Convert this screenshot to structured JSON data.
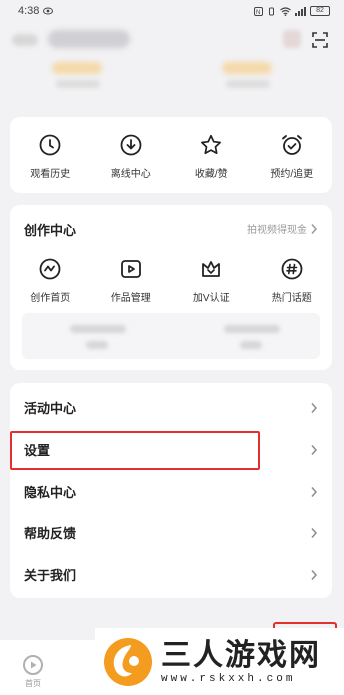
{
  "status_bar": {
    "time": "4:38",
    "battery": "82"
  },
  "quick_actions": [
    {
      "label": "观看历史",
      "icon": "clock-icon"
    },
    {
      "label": "离线中心",
      "icon": "download-cloud-icon"
    },
    {
      "label": "收藏/赞",
      "icon": "star-icon"
    },
    {
      "label": "预约/追更",
      "icon": "alarm-clock-icon"
    }
  ],
  "creator": {
    "title": "创作中心",
    "link": "拍视频得现金",
    "items": [
      {
        "label": "创作首页",
        "icon": "creator-home-icon"
      },
      {
        "label": "作品管理",
        "icon": "video-manage-icon"
      },
      {
        "label": "加V认证",
        "icon": "verify-crown-icon"
      },
      {
        "label": "热门话题",
        "icon": "hashtag-icon"
      }
    ]
  },
  "menu": [
    {
      "label": "活动中心"
    },
    {
      "label": "设置"
    },
    {
      "label": "隐私中心"
    },
    {
      "label": "帮助反馈"
    },
    {
      "label": "关于我们"
    }
  ],
  "bottom_nav": {
    "home_label": "首页"
  },
  "watermark": {
    "title": "三人游戏网",
    "url": "www.rskxxh.com"
  },
  "colors": {
    "highlight": "#e0312f",
    "logo": "#f39c1f"
  }
}
